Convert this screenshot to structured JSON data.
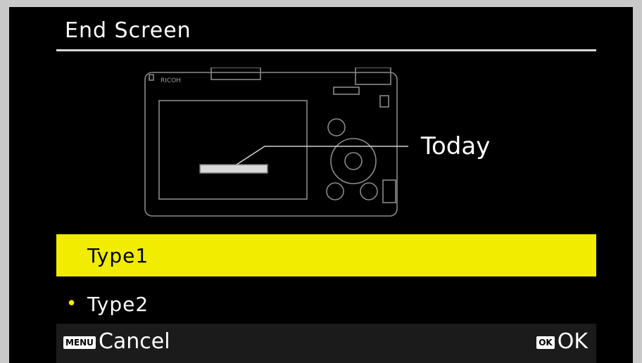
{
  "screen": {
    "title": "End Screen",
    "callout_label": "Today",
    "camera_brand": "RICOH"
  },
  "options": [
    {
      "label": "Type1",
      "selected": true
    },
    {
      "label": "Type2",
      "marked": true
    }
  ],
  "footer": {
    "menu_badge": "MENU",
    "cancel_label": "Cancel",
    "ok_badge": "OK",
    "ok_label": "OK"
  },
  "colors": {
    "background": "#000000",
    "highlight": "#f2ec00",
    "marker": "#f2ec00",
    "footer_bg": "#1b1b1b"
  },
  "icons": {
    "camera": "camera-back-illustration-icon",
    "bullet": "current-setting-dot-icon"
  }
}
